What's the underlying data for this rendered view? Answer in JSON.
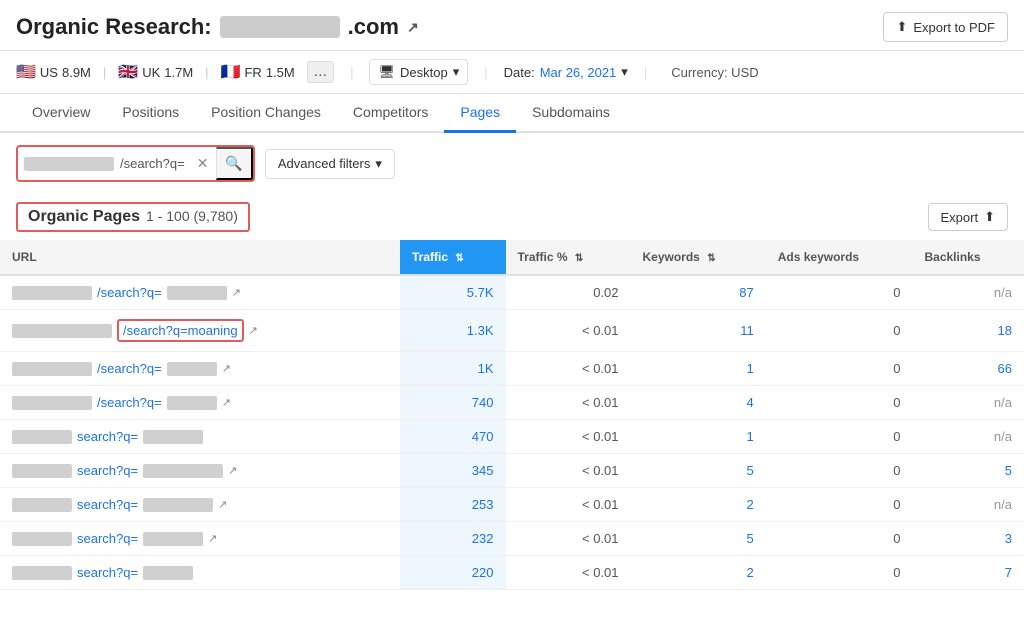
{
  "header": {
    "title": "Organic Research:",
    "domain_display": ".com",
    "export_label": "Export to PDF"
  },
  "country_bar": {
    "countries": [
      {
        "flag": "🇺🇸",
        "code": "US",
        "count": "8.9M"
      },
      {
        "flag": "🇬🇧",
        "code": "UK",
        "count": "1.7M"
      },
      {
        "flag": "🇫🇷",
        "code": "FR",
        "count": "1.5M"
      }
    ],
    "more_label": "...",
    "device_label": "Desktop",
    "device_icon": "🖥",
    "date_label": "Date:",
    "date_value": "Mar 26, 2021",
    "currency_label": "Currency: USD"
  },
  "nav": {
    "tabs": [
      "Overview",
      "Positions",
      "Position Changes",
      "Competitors",
      "Pages",
      "Subdomains"
    ],
    "active_tab": "Pages"
  },
  "filter_bar": {
    "search_value": "/search?q=",
    "advanced_filters_label": "Advanced filters",
    "chevron": "▾"
  },
  "table_section": {
    "title": "Organic Pages",
    "range": "1 - 100 (9,780)",
    "export_label": "Export"
  },
  "columns": {
    "url": "URL",
    "traffic": "Traffic",
    "traffic_pct": "Traffic %",
    "keywords": "Keywords",
    "ads_keywords": "Ads keywords",
    "backlinks": "Backlinks"
  },
  "rows": [
    {
      "url_blur_w": 80,
      "url_text": "/search?q=",
      "url_blur2_w": 60,
      "has_ext": true,
      "highlighted": false,
      "traffic": "5.7K",
      "traffic_pct": "0.02",
      "keywords": "87",
      "ads_keywords": "0",
      "backlinks": "n/a",
      "backlinks_na": true
    },
    {
      "url_blur_w": 100,
      "url_text": "/search?q=moaning",
      "url_blur2_w": 0,
      "has_ext": true,
      "highlighted": true,
      "traffic": "1.3K",
      "traffic_pct": "< 0.01",
      "keywords": "11",
      "ads_keywords": "0",
      "backlinks": "18",
      "backlinks_na": false
    },
    {
      "url_blur_w": 80,
      "url_text": "/search?q=",
      "url_blur2_w": 50,
      "has_ext": true,
      "highlighted": false,
      "traffic": "1K",
      "traffic_pct": "< 0.01",
      "keywords": "1",
      "ads_keywords": "0",
      "backlinks": "66",
      "backlinks_na": false
    },
    {
      "url_blur_w": 80,
      "url_text": "/search?q=",
      "url_blur2_w": 50,
      "has_ext": true,
      "highlighted": false,
      "traffic": "740",
      "traffic_pct": "< 0.01",
      "keywords": "4",
      "ads_keywords": "0",
      "backlinks": "n/a",
      "backlinks_na": true
    },
    {
      "url_blur_w": 60,
      "url_text": "search?q=",
      "url_blur2_w": 60,
      "has_ext": false,
      "highlighted": false,
      "traffic": "470",
      "traffic_pct": "< 0.01",
      "keywords": "1",
      "ads_keywords": "0",
      "backlinks": "n/a",
      "backlinks_na": true
    },
    {
      "url_blur_w": 60,
      "url_text": "search?q=",
      "url_blur2_w": 80,
      "has_ext": true,
      "highlighted": false,
      "traffic": "345",
      "traffic_pct": "< 0.01",
      "keywords": "5",
      "ads_keywords": "0",
      "backlinks": "5",
      "backlinks_na": false
    },
    {
      "url_blur_w": 60,
      "url_text": "search?q=",
      "url_blur2_w": 70,
      "has_ext": true,
      "highlighted": false,
      "traffic": "253",
      "traffic_pct": "< 0.01",
      "keywords": "2",
      "ads_keywords": "0",
      "backlinks": "n/a",
      "backlinks_na": true
    },
    {
      "url_blur_w": 60,
      "url_text": "search?q=",
      "url_blur2_w": 60,
      "has_ext": true,
      "highlighted": false,
      "traffic": "232",
      "traffic_pct": "< 0.01",
      "keywords": "5",
      "ads_keywords": "0",
      "backlinks": "3",
      "backlinks_na": false
    },
    {
      "url_blur_w": 60,
      "url_text": "search?q=",
      "url_blur2_w": 50,
      "has_ext": false,
      "highlighted": false,
      "traffic": "220",
      "traffic_pct": "< 0.01",
      "keywords": "2",
      "ads_keywords": "0",
      "backlinks": "7",
      "backlinks_na": false
    }
  ]
}
